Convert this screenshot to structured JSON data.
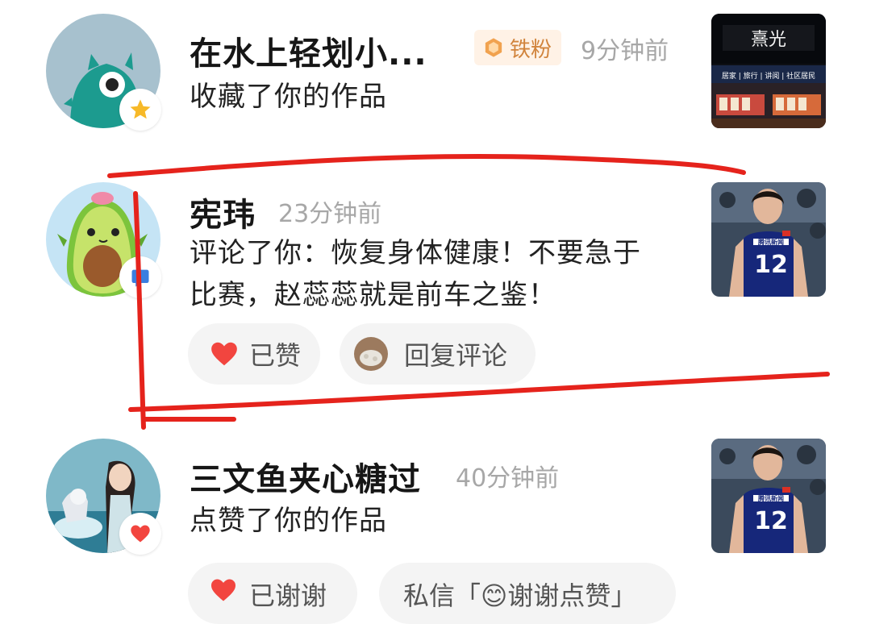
{
  "notifications": [
    {
      "user": "在水上轻划小...",
      "fan_badge": "铁粉",
      "time": "9分钟前",
      "action": "收藏了你的作品",
      "badge_icon": "star-icon",
      "thumbnail": "storefront-photo",
      "thumbnail_sign": "熹光",
      "thumbnail_tags": "居家 | 旅行 | 讲阅 | 社区居民"
    },
    {
      "user": "宪玮",
      "time": "23分钟前",
      "action_line1": "评论了你：恢复身体健康！不要急于",
      "action_line2": "比赛，赵蕊蕊就是前车之鉴！",
      "badge_icon": "comment-icon",
      "thumbnail": "volleyball-player-photo",
      "jersey_number": "12",
      "jersey_text": "腾讯新闻",
      "actions": {
        "liked_label": "已赞",
        "reply_label": "回复评论"
      }
    },
    {
      "user": "三文鱼夹心糖过",
      "time": "40分钟前",
      "action": "点赞了你的作品",
      "badge_icon": "heart-icon",
      "thumbnail": "volleyball-player-photo",
      "jersey_number": "12",
      "jersey_text": "腾讯新闻",
      "actions": {
        "thanks_label": "已谢谢",
        "dm_label": "私信「😊谢谢点赞」"
      }
    }
  ],
  "colors": {
    "annotation_red": "#e5231c",
    "like_red": "#f2453f",
    "fan_orange": "#d1843c"
  }
}
